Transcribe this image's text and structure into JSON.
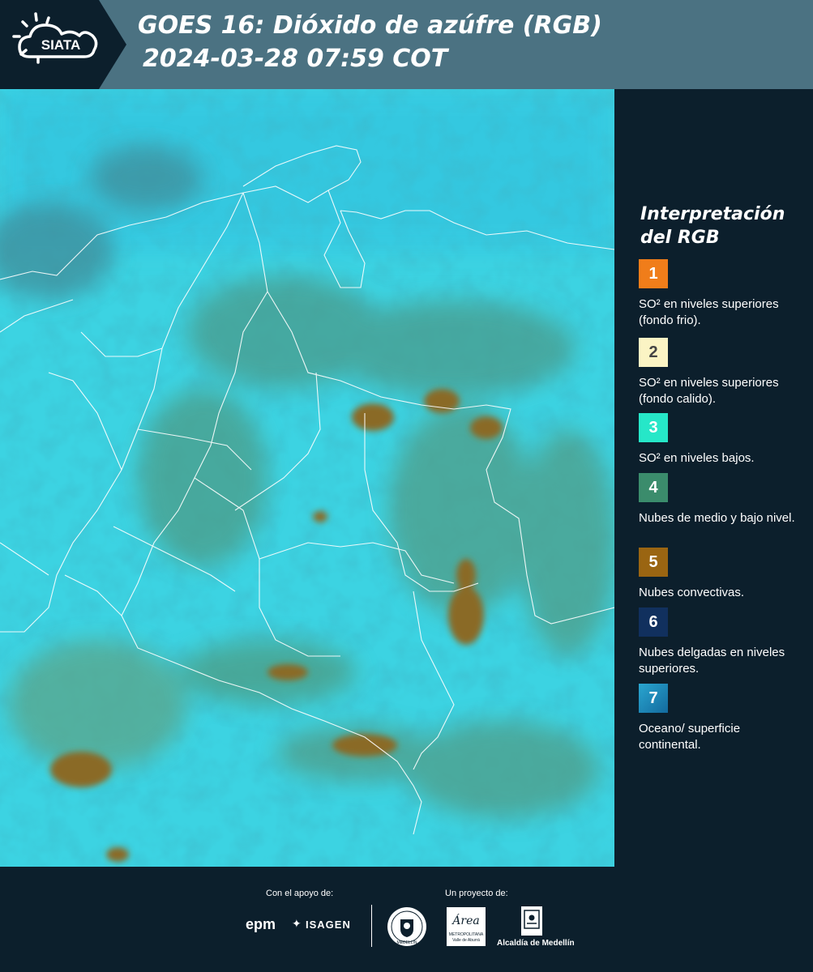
{
  "header": {
    "logo_text": "SIATA",
    "title_line1": "GOES 16: Dióxido de azúfre (RGB)",
    "title_line2": "2024-03-28 07:59 COT"
  },
  "legend": {
    "title": "Interpretación del RGB",
    "items": [
      {
        "number": "1",
        "color": "#f07d1a",
        "text": "SO² en niveles superiores (fondo frio)."
      },
      {
        "number": "2",
        "color": "#fbf4c4",
        "text": "SO² en niveles superiores (fondo calido)."
      },
      {
        "number": "3",
        "color": "#26e7c8",
        "text": "SO² en niveles bajos."
      },
      {
        "number": "4",
        "color": "#3b8c6c",
        "text": "Nubes de medio y bajo nivel."
      },
      {
        "number": "5",
        "color": "#9a6512",
        "text": "Nubes convectivas."
      },
      {
        "number": "6",
        "color": "#11305e",
        "text": "Nubes delgadas en niveles superiores."
      },
      {
        "number": "7",
        "color": "#1e8cbc",
        "text": "Oceano/ superficie continental."
      }
    ]
  },
  "footer": {
    "support_label": "Con el apoyo de:",
    "project_label": "Un proyecto de:",
    "sponsors": [
      "epm",
      "ISAGEN"
    ],
    "partner_area_text": "Área",
    "partner_area_sub1": "METROPOLITANA",
    "partner_area_sub2": "Valle de Aburrá",
    "partner_alcaldia": "Alcaldía de Medellín",
    "seal_text": "MEDELLÍN"
  }
}
